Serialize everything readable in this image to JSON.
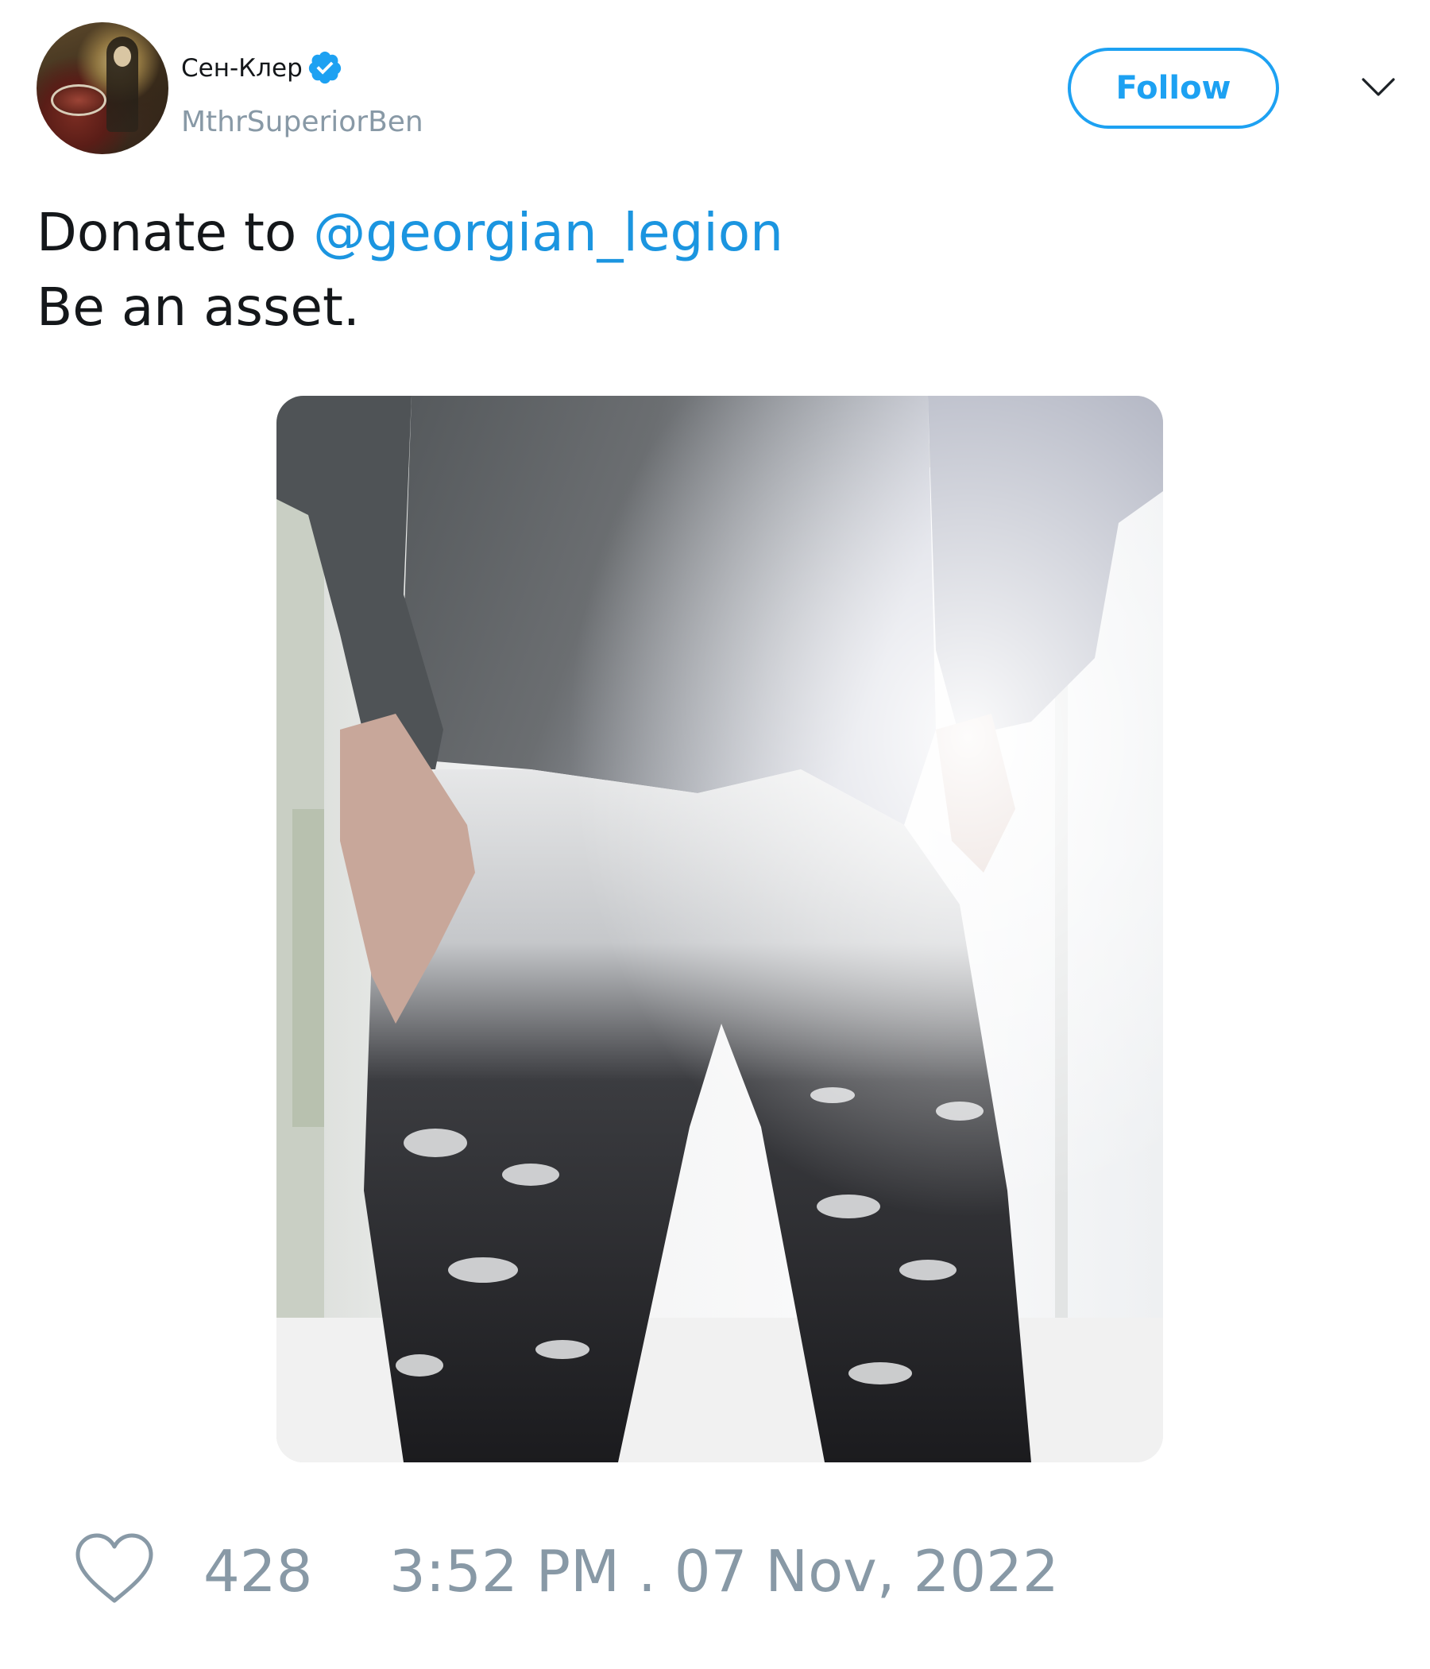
{
  "author": {
    "display_name": "Сен-Клер",
    "handle": "MthrSuperiorBen",
    "verified": true,
    "avatar_icon": "avatar-image"
  },
  "header": {
    "follow_label": "Follow",
    "menu_icon": "chevron-down-icon"
  },
  "tweet": {
    "text_prefix": "Donate to ",
    "mention": "@georgian_legion",
    "text_line2": "Be an asset."
  },
  "media": {
    "icon": "photo"
  },
  "footer": {
    "like_icon": "heart-icon",
    "like_count": "428",
    "timestamp": "3:52 PM . 07 Nov, 2022"
  },
  "colors": {
    "accent": "#1da1f2",
    "mention": "#1b95e0",
    "muted": "#8899a6",
    "text": "#14171a"
  }
}
